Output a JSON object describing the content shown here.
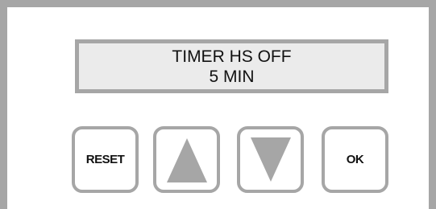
{
  "display": {
    "line1": "TIMER HS OFF",
    "line2": "5 MIN"
  },
  "buttons": {
    "reset_label": "RESET",
    "up_icon": "arrow-up-triangle",
    "down_icon": "arrow-down-triangle",
    "ok_label": "OK"
  },
  "colors": {
    "frame": "#a6a6a6",
    "lcd_background": "#ebebeb",
    "arrow_fill": "#a6a6a6"
  }
}
